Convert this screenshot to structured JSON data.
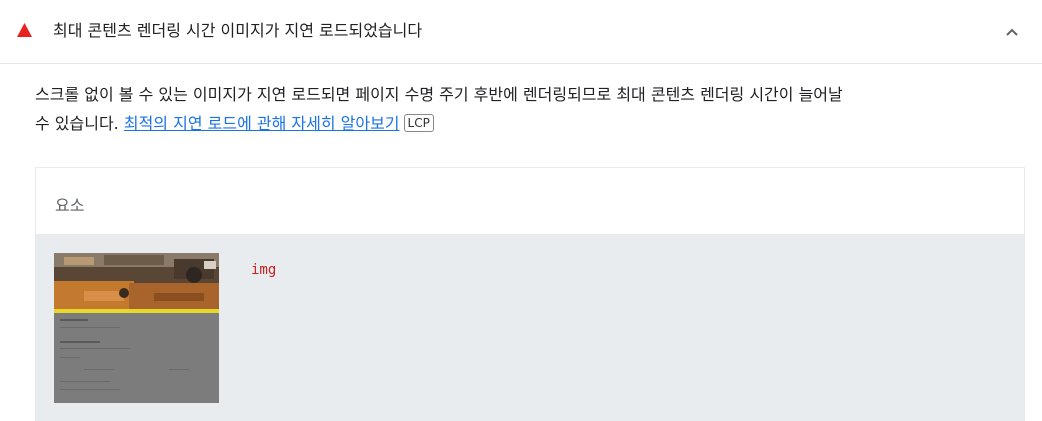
{
  "audit": {
    "title": "최대 콘텐츠 렌더링 시간 이미지가 지연 로드되었습니다",
    "status_color": "#e8231f",
    "status_icon": "warning-triangle-icon",
    "collapse_icon": "chevron-up-icon"
  },
  "description": {
    "line1": "스크롤 없이 볼 수 있는 이미지가 지연 로드되면 페이지 수명 주기 후반에 렌더링되므로 최대 콘텐츠 렌더링 시간이 늘어날",
    "line2_prefix": "수 있습니다. ",
    "link_text": "최적의 지연 로드에 관해 자세히 알아보기",
    "badge": "LCP"
  },
  "table": {
    "column_header": "요소",
    "rows": [
      {
        "node": "img"
      }
    ]
  },
  "colors": {
    "link": "#1a73e8",
    "node_text": "#c5221f",
    "row_bg": "#e9ecef"
  }
}
